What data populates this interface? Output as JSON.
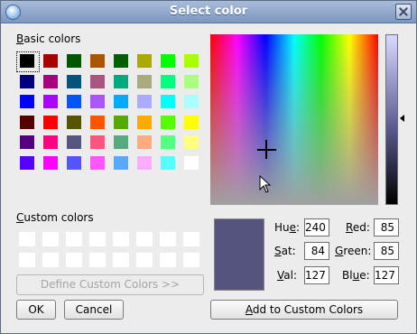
{
  "window": {
    "title": "Select color"
  },
  "labels": {
    "basic_pre": "B",
    "basic_post": "asic colors",
    "custom_pre": "C",
    "custom_post": "ustom colors",
    "hue_pre": "Hu",
    "hue_u": "e",
    "hue_post": ":",
    "sat_pre": "",
    "sat_u": "S",
    "sat_post": "at:",
    "val_pre": "",
    "val_u": "V",
    "val_post": "al:",
    "red_pre": "",
    "red_u": "R",
    "red_post": "ed:",
    "green_pre": "",
    "green_u": "G",
    "green_post": "reen:",
    "blue_pre": "Bl",
    "blue_u": "u",
    "blue_post": "e:"
  },
  "fields": {
    "hue": "240",
    "sat": "84",
    "val": "127",
    "red": "85",
    "green": "85",
    "blue": "127"
  },
  "buttons": {
    "define_custom": "Define Custom Colors >>",
    "ok": "OK",
    "cancel": "Cancel",
    "add_pre": "",
    "add_u": "A",
    "add_post": "dd to Custom Colors"
  },
  "basic_colors": [
    [
      "#000000",
      "#aa0000",
      "#005500",
      "#aa5500",
      "#005f00",
      "#aaaa00",
      "#00ff00",
      "#aaff00"
    ],
    [
      "#00007f",
      "#aa007f",
      "#00557f",
      "#aa557f",
      "#00aa7f",
      "#aaaa7f",
      "#00ff7f",
      "#aaff7f"
    ],
    [
      "#0000ff",
      "#aa00ff",
      "#0055ff",
      "#aa55ff",
      "#00aaff",
      "#aaaaff",
      "#00ffff",
      "#aaffff"
    ],
    [
      "#550000",
      "#ff0000",
      "#555500",
      "#ff5500",
      "#55aa00",
      "#ffaa00",
      "#55ff00",
      "#ffff00"
    ],
    [
      "#55007f",
      "#ff007f",
      "#55557f",
      "#ff557f",
      "#55aa7f",
      "#ffaa7f",
      "#55ff7f",
      "#ffff7f"
    ],
    [
      "#5500ff",
      "#ff00ff",
      "#5555ff",
      "#ff55ff",
      "#55aaff",
      "#ffaaff",
      "#55ffff",
      "#ffffff"
    ]
  ],
  "current_color": "#54547f"
}
